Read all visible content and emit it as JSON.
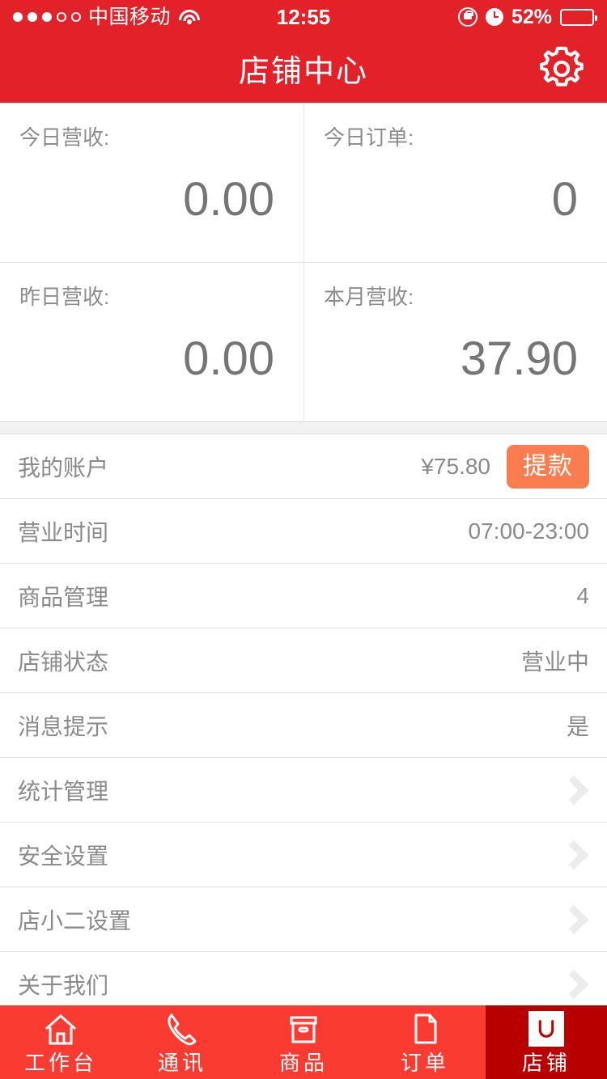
{
  "status_bar": {
    "signal_filled": 3,
    "signal_total": 5,
    "carrier": "中国移动",
    "wifi_icon": "wifi-icon",
    "time": "12:55",
    "rotation_lock_icon": "rotation-lock-icon",
    "alarm_icon": "alarm-clock-icon",
    "battery_percent": "52%",
    "battery_level": 52
  },
  "header": {
    "title": "店铺中心",
    "settings_icon": "gear-icon",
    "background_color": "#e32128"
  },
  "stats": [
    [
      {
        "label": "今日营收:",
        "value": "0.00"
      },
      {
        "label": "今日订单:",
        "value": "0"
      }
    ],
    [
      {
        "label": "昨日营收:",
        "value": "0.00"
      },
      {
        "label": "本月营收:",
        "value": "37.90"
      }
    ]
  ],
  "list": [
    {
      "label": "我的账户",
      "value": "¥75.80",
      "button": "提款",
      "button_color": "#fa7d4f",
      "chevron": false
    },
    {
      "label": "营业时间",
      "value": "07:00-23:00",
      "chevron": false
    },
    {
      "label": "商品管理",
      "value": "4",
      "chevron": false
    },
    {
      "label": "店铺状态",
      "value": "营业中",
      "chevron": false
    },
    {
      "label": "消息提示",
      "value": "是",
      "chevron": false
    },
    {
      "label": "统计管理",
      "value": "",
      "chevron": true
    },
    {
      "label": "安全设置",
      "value": "",
      "chevron": true
    },
    {
      "label": "店小二设置",
      "value": "",
      "chevron": true
    },
    {
      "label": "关于我们",
      "value": "",
      "chevron": true
    }
  ],
  "tabbar": {
    "background_color": "#fa3b32",
    "active_color": "#b90000",
    "items": [
      {
        "label": "工作台",
        "icon": "home-icon",
        "active": false
      },
      {
        "label": "通讯",
        "icon": "phone-icon",
        "active": false
      },
      {
        "label": "商品",
        "icon": "box-icon",
        "active": false
      },
      {
        "label": "订单",
        "icon": "document-icon",
        "active": false
      },
      {
        "label": "店铺",
        "icon": "shop-icon",
        "active": true
      }
    ]
  }
}
